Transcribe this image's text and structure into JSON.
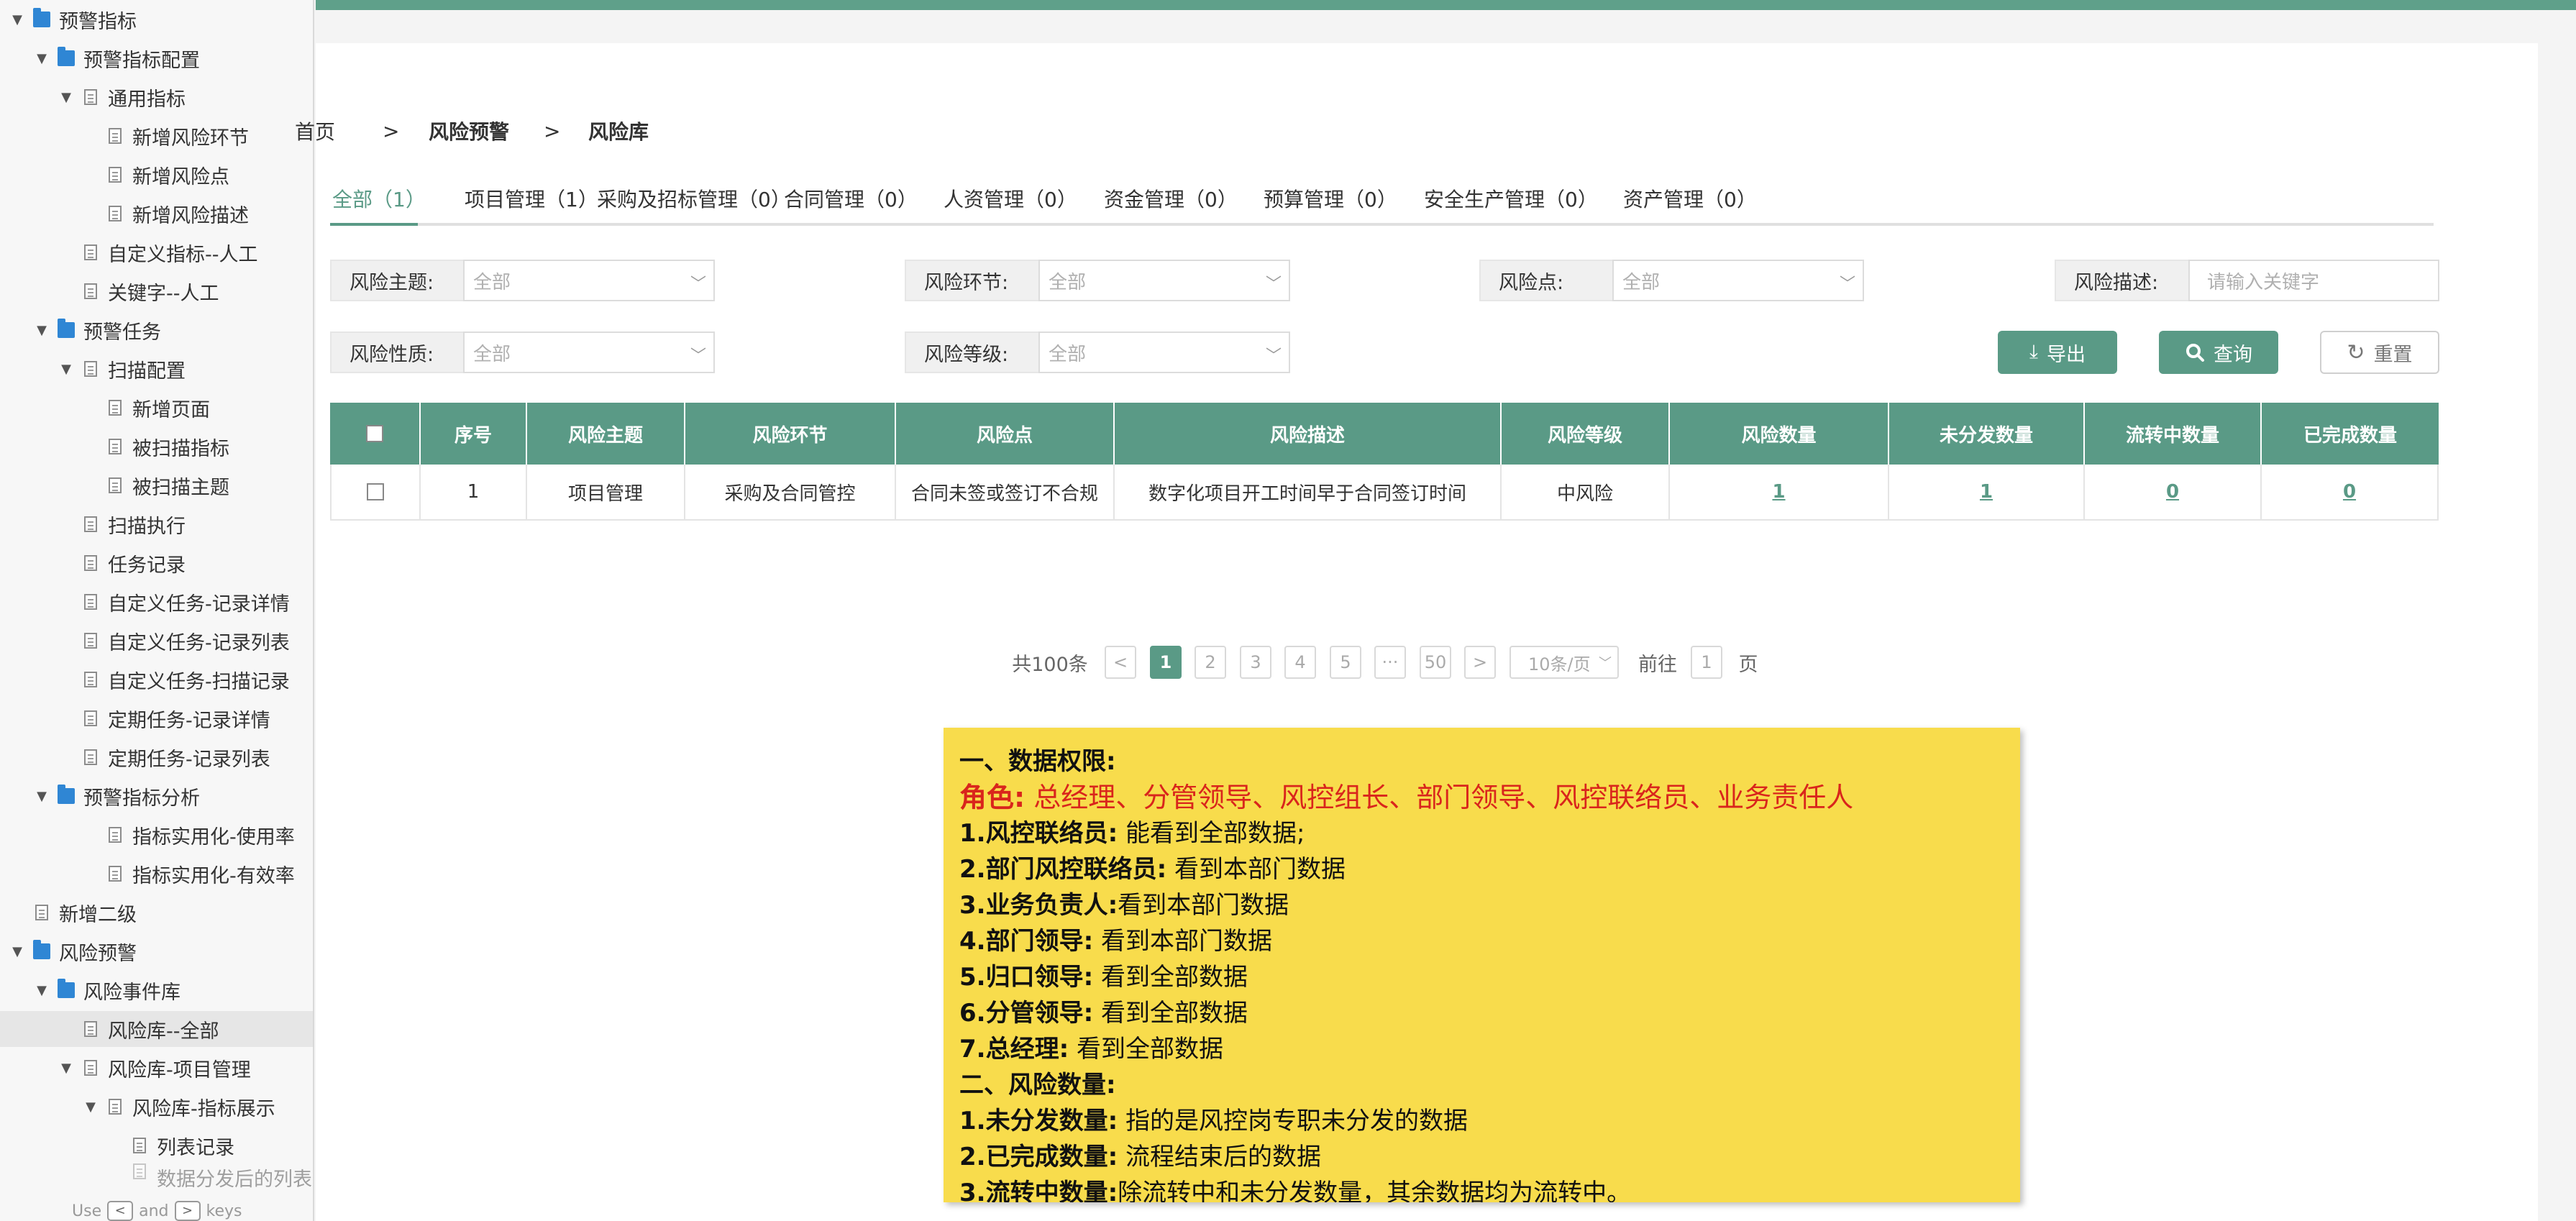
{
  "sidebar": {
    "items": [
      {
        "label": "预警指标",
        "type": "folder",
        "expanded": true
      },
      {
        "label": "预警指标配置",
        "type": "folder",
        "expanded": true
      },
      {
        "label": "通用指标",
        "type": "doc",
        "expanded": true
      },
      {
        "label": "新增风险环节",
        "type": "doc"
      },
      {
        "label": "新增风险点",
        "type": "doc"
      },
      {
        "label": "新增风险描述",
        "type": "doc"
      },
      {
        "label": "自定义指标--人工",
        "type": "doc"
      },
      {
        "label": "关键字--人工",
        "type": "doc"
      },
      {
        "label": "预警任务",
        "type": "folder",
        "expanded": true
      },
      {
        "label": "扫描配置",
        "type": "doc",
        "expanded": true
      },
      {
        "label": "新增页面",
        "type": "doc"
      },
      {
        "label": "被扫描指标",
        "type": "doc"
      },
      {
        "label": "被扫描主题",
        "type": "doc"
      },
      {
        "label": "扫描执行",
        "type": "doc"
      },
      {
        "label": "任务记录",
        "type": "doc"
      },
      {
        "label": "自定义任务-记录详情",
        "type": "doc"
      },
      {
        "label": "自定义任务-记录列表",
        "type": "doc"
      },
      {
        "label": "自定义任务-扫描记录",
        "type": "doc"
      },
      {
        "label": "定期任务-记录详情",
        "type": "doc"
      },
      {
        "label": "定期任务-记录列表",
        "type": "doc"
      },
      {
        "label": "预警指标分析",
        "type": "folder",
        "expanded": true
      },
      {
        "label": "指标实用化-使用率",
        "type": "doc"
      },
      {
        "label": "指标实用化-有效率",
        "type": "doc"
      },
      {
        "label": "新增二级",
        "type": "doc"
      },
      {
        "label": "风险预警",
        "type": "folder",
        "expanded": true
      },
      {
        "label": "风险事件库",
        "type": "folder",
        "expanded": true
      },
      {
        "label": "风险库--全部",
        "type": "doc",
        "selected": true
      },
      {
        "label": "风险库-项目管理",
        "type": "doc",
        "expanded": true
      },
      {
        "label": "风险库-指标展示",
        "type": "doc",
        "expanded": true
      },
      {
        "label": "列表记录",
        "type": "doc"
      },
      {
        "label": "数据分发后的列表",
        "type": "doc"
      }
    ],
    "hint": {
      "prefix": "Use",
      "key1": "<",
      "middle": "and",
      "key2": ">",
      "suffix": "keys"
    }
  },
  "breadcrumb": {
    "home": "首页",
    "sep": ">",
    "level1": "风险预警",
    "level2": "风险库"
  },
  "tabs": [
    {
      "label": "全部（1）",
      "active": true
    },
    {
      "label": "项目管理（1）"
    },
    {
      "label": "采购及招标管理（0）"
    },
    {
      "label": "合同管理（0）"
    },
    {
      "label": "人资管理（0）"
    },
    {
      "label": "资金管理（0）"
    },
    {
      "label": "预算管理（0）"
    },
    {
      "label": "安全生产管理（0）"
    },
    {
      "label": "资产管理（0）"
    }
  ],
  "filters": {
    "theme": {
      "label": "风险主题:",
      "value": "全部"
    },
    "link": {
      "label": "风险环节:",
      "value": "全部"
    },
    "point": {
      "label": "风险点:",
      "value": "全部"
    },
    "desc": {
      "label": "风险描述:",
      "placeholder": "请输入关键字"
    },
    "nature": {
      "label": "风险性质:",
      "value": "全部"
    },
    "level": {
      "label": "风险等级:",
      "value": "全部"
    }
  },
  "buttons": {
    "export": "导出",
    "query": "查询",
    "reset": "重置"
  },
  "table": {
    "columns": [
      "序号",
      "风险主题",
      "风险环节",
      "风险点",
      "风险描述",
      "风险等级",
      "风险数量",
      "未分发数量",
      "流转中数量",
      "已完成数量"
    ],
    "rows": [
      {
        "no": "1",
        "theme": "项目管理",
        "link": "采购及合同管控",
        "point": "合同未签或签订不合规",
        "desc": "数字化项目开工时间早于合同签订时间",
        "level": "中风险",
        "count": "1",
        "undistributed": "1",
        "in_flow": "0",
        "completed": "0"
      }
    ]
  },
  "pagination": {
    "total": "共100条",
    "prev": "<",
    "pages": [
      "1",
      "2",
      "3",
      "4",
      "5",
      "···",
      "50"
    ],
    "next": ">",
    "page_size": "10条/页",
    "goto_prefix": "前往",
    "goto_value": "1",
    "goto_suffix": "页"
  },
  "note": {
    "s1_title": "一、数据权限:",
    "roles_label": "角色:",
    "roles_text": "总经理、分管领导、风控组长、部门领导、风控联络员、业务责任人",
    "p1_label": "1.风控联络员:",
    "p1_text": "能看到全部数据;",
    "p2_label": "2.部门风控联络员:",
    "p2_text": "看到本部门数据",
    "p3_label": "3.业务负责人:",
    "p3_text": "看到本部门数据",
    "p4_label": "4.部门领导:",
    "p4_text": "看到本部门数据",
    "p5_label": "5.归口领导:",
    "p5_text": "看到全部数据",
    "p6_label": "6.分管领导:",
    "p6_text": "看到全部数据",
    "p7_label": "7.总经理:",
    "p7_text": "看到全部数据",
    "s2_title": "二、风险数量:",
    "q1_label": "1.未分发数量:",
    "q1_text": "指的是风控岗专职未分发的数据",
    "q2_label": "2.已完成数量:",
    "q2_text": "流程结束后的数据",
    "q3_label": "3.流转中数量:",
    "q3_text": "除流转中和未分发数量，其余数据均为流转中。"
  },
  "colors": {
    "accent": "#5a9a86",
    "note_bg": "#f8dc4c",
    "note_red": "#d9251c",
    "folder": "#2f86d4"
  }
}
